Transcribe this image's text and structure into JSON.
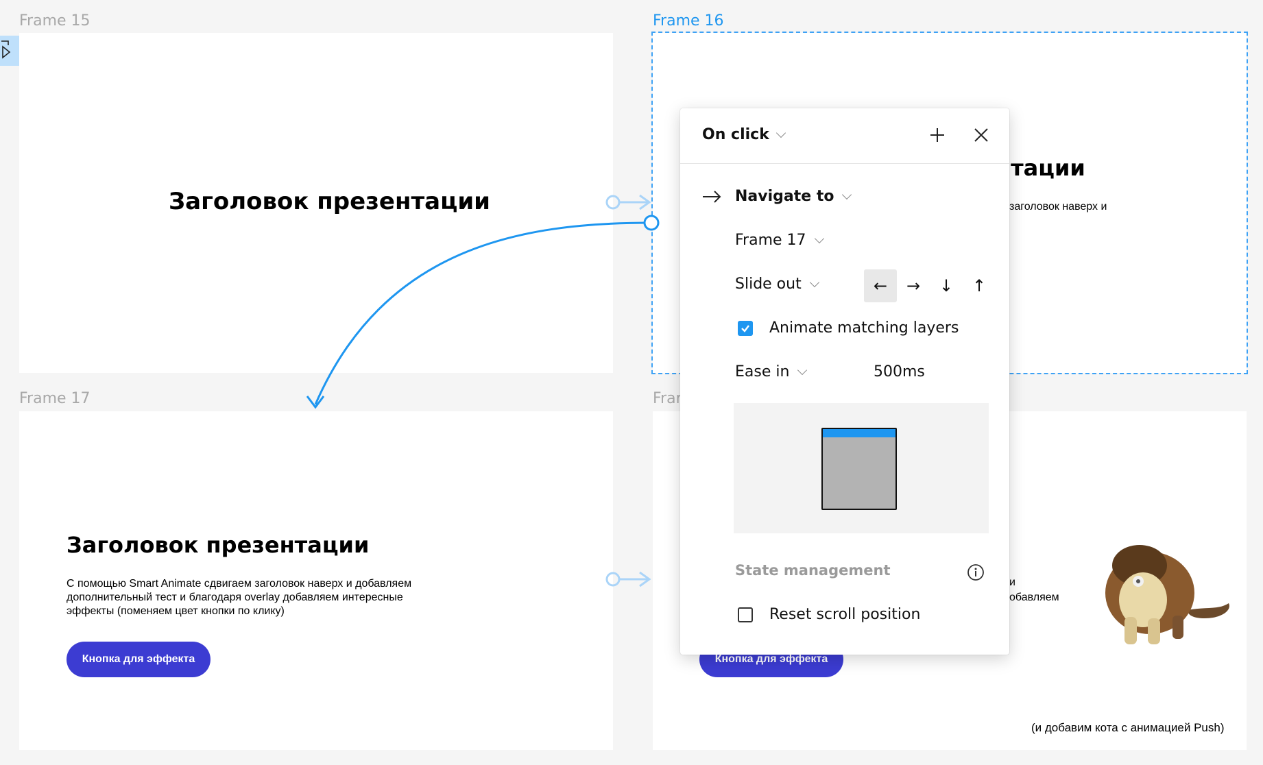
{
  "frames": {
    "f15": {
      "label": "Frame 15",
      "headline": "Заголовок презентации"
    },
    "f16": {
      "label": "Frame 16",
      "headline_partial": "нтации",
      "body_partial": "заголовок наверх и"
    },
    "f17": {
      "label": "Frame 17",
      "headline": "Заголовок презентации",
      "body": "С помощью Smart Animate сдвигаем заголовок наверх и добавляем дополнительный тест и благодаря overlay добавляем интересные эффекты (поменяем цвет кнопки по клику)",
      "button": "Кнопка для эффекта"
    },
    "f18": {
      "label_partial": "Frar",
      "body_partial_1": "и",
      "body_partial_2": "обавляем",
      "button": "Кнопка для эффекта",
      "caption": "(и добавим кота с анимацией Push)"
    }
  },
  "interaction": {
    "trigger": "On click",
    "action": "Navigate to",
    "destination": "Frame 17",
    "animation": "Slide out",
    "directions": [
      "←",
      "→",
      "↓",
      "↑"
    ],
    "selected_direction": "←",
    "animate_matching_layers": {
      "label": "Animate matching layers",
      "checked": true
    },
    "easing": "Ease in",
    "duration": "500ms",
    "state_management": "State management",
    "reset_scroll": {
      "label": "Reset scroll position",
      "checked": false
    }
  },
  "colors": {
    "accent": "#1e96f0",
    "button": "#3c3cd2",
    "canvas": "#f5f5f5"
  }
}
